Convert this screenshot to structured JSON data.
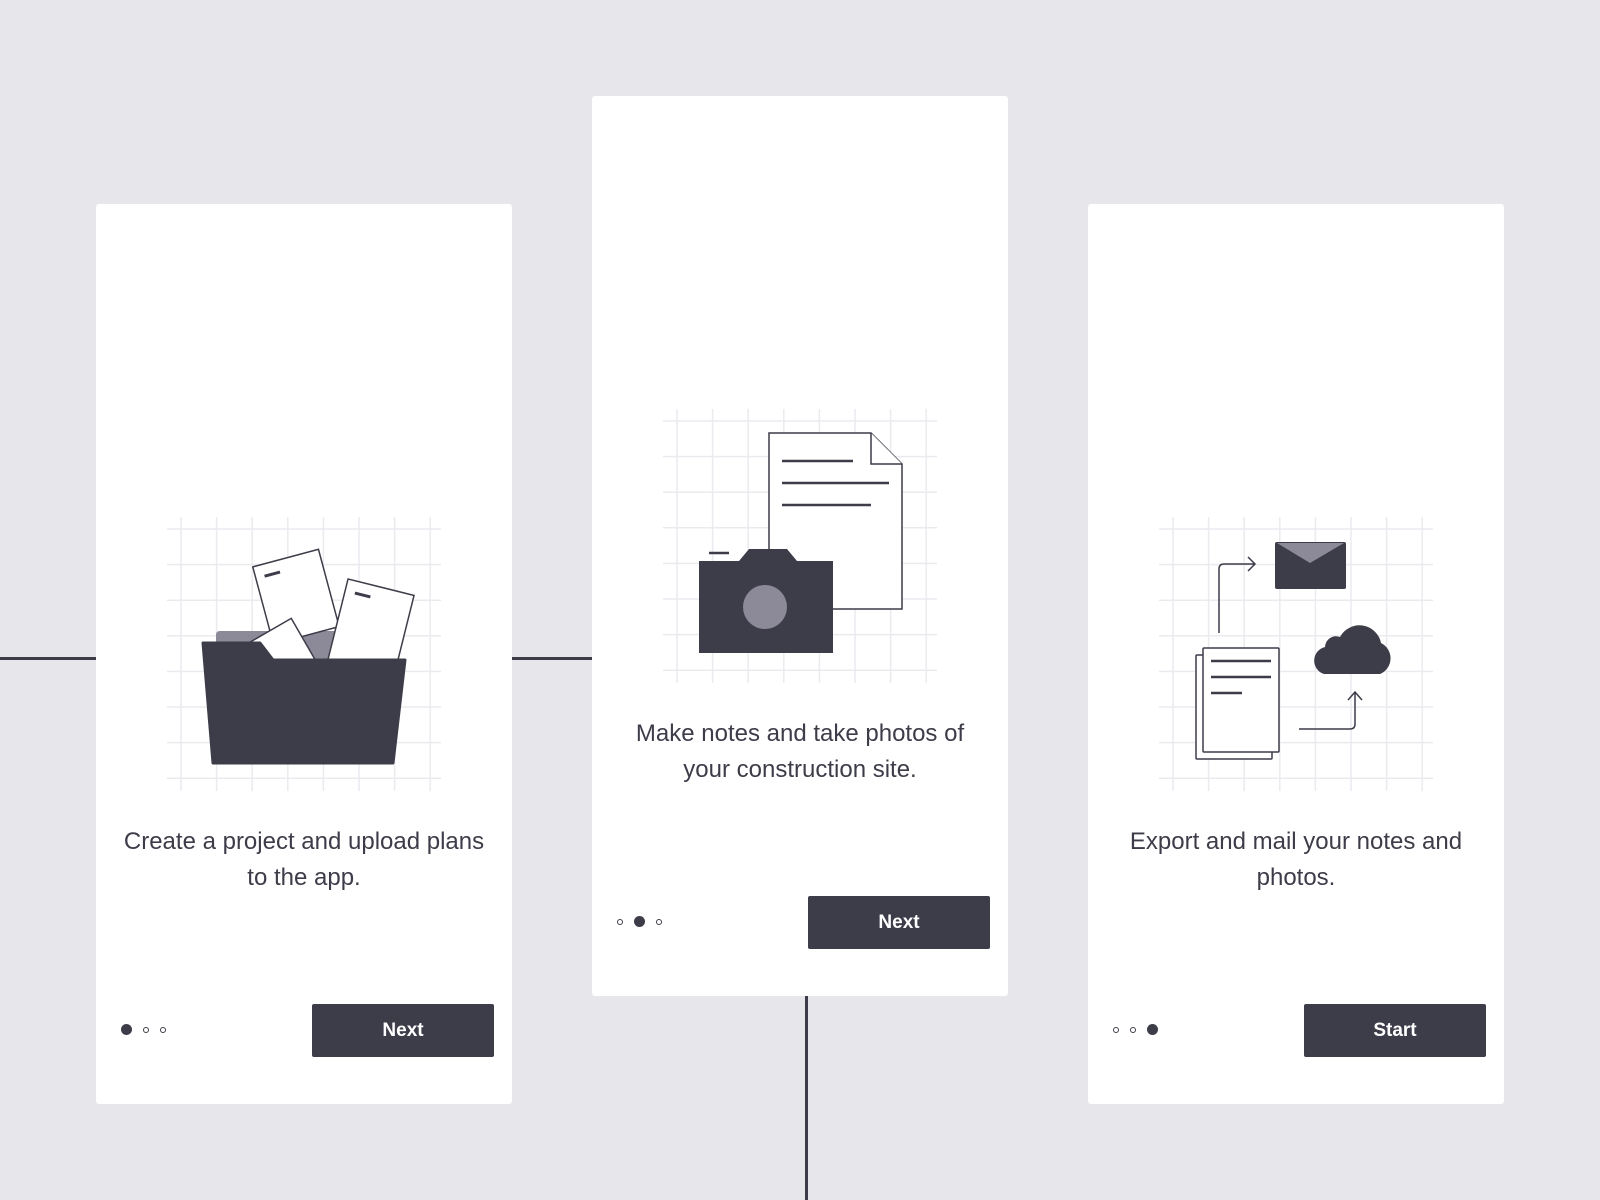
{
  "colors": {
    "background": "#e7e6eb",
    "card": "#ffffff",
    "accent": "#3d3c49",
    "muted": "#8c8a99",
    "grid": "#ebeaef"
  },
  "screens": [
    {
      "illustration": "folder-with-documents-icon",
      "text": "Create a project and upload plans to the app.",
      "button": "Next",
      "active_dot": 0
    },
    {
      "illustration": "camera-and-document-icon",
      "text": "Make notes and take photos of your construction site.",
      "button": "Next",
      "active_dot": 1
    },
    {
      "illustration": "export-mail-cloud-icon",
      "text": "Export and mail your notes and photos.",
      "button": "Start",
      "active_dot": 2
    }
  ]
}
